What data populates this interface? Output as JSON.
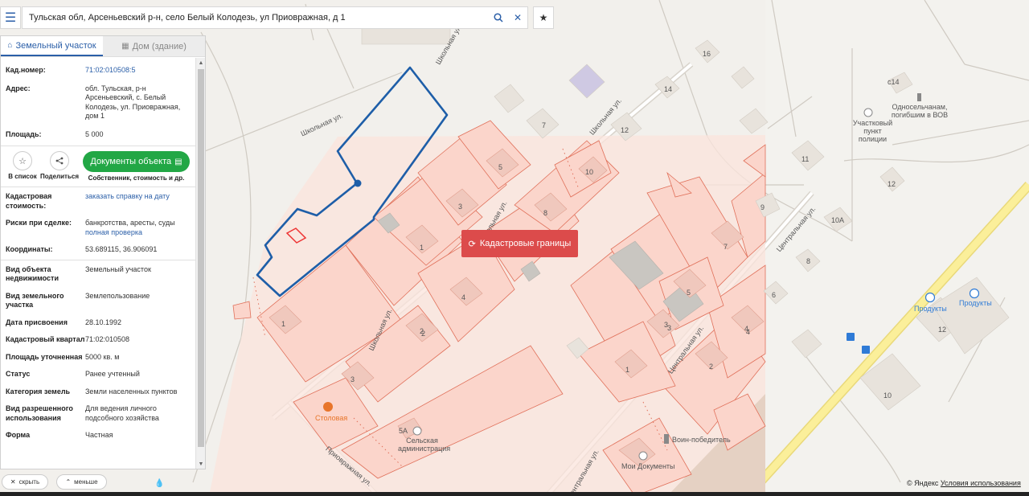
{
  "search": {
    "value": "Тульская обл, Арсеньевский р-н, село Белый Колодезь, ул Приовражная, д 1"
  },
  "tabs": [
    {
      "label": "Земельный участок",
      "active": true
    },
    {
      "label": "Дом (здание)",
      "active": false
    }
  ],
  "parcel": {
    "cad_label": "Кад.номер:",
    "cad_value": "71:02:010508:5",
    "addr_label": "Адрес:",
    "addr_value": "обл. Тульская, р-н Арсеньевский, с. Белый Колодезь, ул. Приовражная, дом 1",
    "area_label": "Площадь:",
    "area_value": "5 000"
  },
  "actions": {
    "list_label": "В список",
    "share_label": "Поделиться",
    "docs_button": "Документы объекта",
    "docs_caption": "Собственник, стоимость и др."
  },
  "details": {
    "cost_label": "Кадастровая стоимость:",
    "cost_link": "заказать справку на дату",
    "risk_label": "Риски при сделке:",
    "risk_value": "банкротства, аресты, суды",
    "risk_link": "полная проверка",
    "coords_label": "Координаты:",
    "coords_value": "53.689115, 36.906091"
  },
  "props": [
    {
      "label": "Вид объекта недвижимости",
      "value": "Земельный участок"
    },
    {
      "label": "Вид земельного участка",
      "value": "Землепользование"
    },
    {
      "label": "Дата присвоения",
      "value": "28.10.1992"
    },
    {
      "label": "Кадастровый квартал",
      "value": "71:02:010508"
    },
    {
      "label": "Площадь уточненная",
      "value": "5000 кв. м"
    },
    {
      "label": "Статус",
      "value": "Ранее учтенный"
    },
    {
      "label": "Категория земель",
      "value": "Земли населенных пунктов"
    },
    {
      "label": "Вид разрешенного использования",
      "value": "Для ведения личного подсобного хозяйства"
    },
    {
      "label": "Форма",
      "value": "Частная"
    }
  ],
  "bottom": {
    "hide": "скрыть",
    "less": "меньше"
  },
  "map": {
    "cad_button": "Кадастровые границы",
    "streets": {
      "shkolnaya1": "Школьная ул.",
      "shkolnaya2": "Школьная ул.",
      "shkolnaya3": "Школьная ул.",
      "shkolnaya4": "Школьная ул.",
      "shkolnaya5": "Школьная ул.",
      "tsentr1": "Центральная ул.",
      "tsentr2": "Центральная ул.",
      "tsentr3": "Центральная ул.",
      "priovr": "Приовражная ул."
    },
    "pois": {
      "police": "Участковый пункт полиции",
      "memorial": "Односельчанам, погибшим в ВОВ",
      "shop1": "Продукты",
      "shop2": "Продукты",
      "canteen": "Столовая",
      "admin": "Сельская администрация",
      "docs": "Мои Документы",
      "winner": "Воин-победитель"
    },
    "house_numbers": [
      "16",
      "14",
      "c14",
      "7",
      "12",
      "11",
      "12",
      "9",
      "10А",
      "8",
      "6",
      "7",
      "5",
      "3",
      "4",
      "2",
      "10",
      "12",
      "10",
      "5",
      "3",
      "1",
      "8",
      "4",
      "2",
      "1",
      "3",
      "5А",
      "1",
      "2",
      "3",
      "4"
    ],
    "copyright": "© Яндекс",
    "terms": "Условия использования"
  },
  "colors": {
    "accent": "#2b5fa8",
    "green": "#22a745",
    "red": "#dc4b4b",
    "parcel_outline": "#1e5ea8",
    "cad_fill": "#fbdcd4",
    "cad_stroke": "#e0705a"
  }
}
